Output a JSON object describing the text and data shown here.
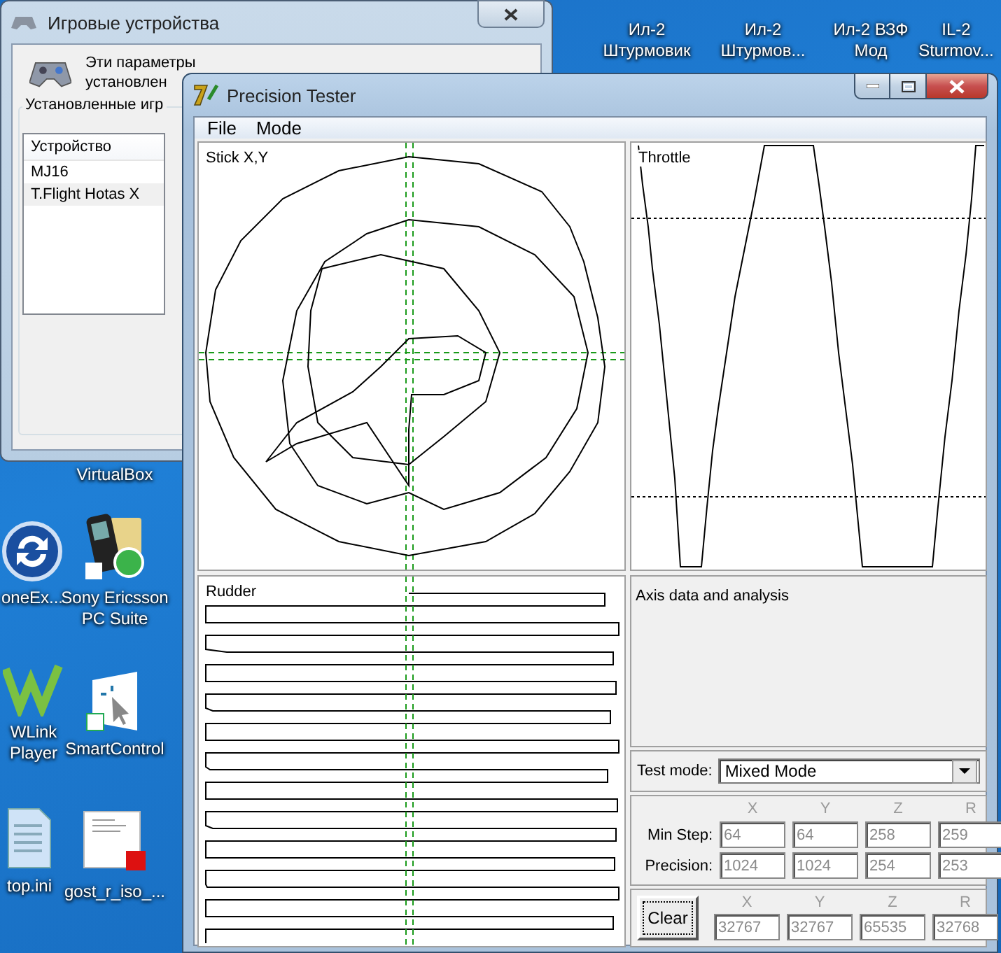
{
  "desktop_icons": [
    {
      "kind": "none",
      "lines": [
        "Ил-2",
        "Штурмовик"
      ]
    },
    {
      "kind": "none",
      "lines": [
        "Ил-2",
        "Штурмов..."
      ]
    },
    {
      "kind": "none",
      "lines": [
        "Ил-2 ВЗФ",
        "Мод"
      ]
    },
    {
      "kind": "none",
      "lines": [
        "IL-2",
        "Sturmov..."
      ]
    },
    {
      "kind": "none",
      "lines": [
        "VirtualBox"
      ]
    },
    {
      "kind": "sync",
      "lines": [
        "oneEx..."
      ]
    },
    {
      "kind": "phone",
      "lines": [
        "Sony Ericsson",
        "PC Suite"
      ]
    },
    {
      "kind": "player",
      "lines": [
        "WLink",
        "Player"
      ]
    },
    {
      "kind": "cursor",
      "lines": [
        "SmartControl"
      ]
    },
    {
      "kind": "file",
      "lines": [
        "top.ini"
      ]
    },
    {
      "kind": "pdf",
      "lines": [
        "gost_r_iso_..."
      ]
    }
  ],
  "back_window": {
    "title": "Игровые устройства",
    "description": [
      "Эти параметры",
      "установлен"
    ],
    "group_label": "Установленные игр",
    "list_header": "Устройство",
    "devices": [
      {
        "name": "MJ16",
        "selected": false
      },
      {
        "name": "T.Flight Hotas X",
        "selected": true
      }
    ]
  },
  "window": {
    "title": "Precision Tester",
    "menu": [
      "File",
      "Mode"
    ],
    "plots": {
      "stick": "Stick X,Y",
      "throttle": "Throttle",
      "rudder": "Rudder"
    },
    "analysis_text": "Axis data and analysis",
    "test_mode": {
      "label": "Test mode:",
      "value": "Mixed Mode"
    },
    "columns": [
      "X",
      "Y",
      "Z",
      "R"
    ],
    "rows": [
      {
        "label": "Min Step:",
        "values": [
          "64",
          "64",
          "258",
          "259"
        ]
      },
      {
        "label": "Precision:",
        "values": [
          "1024",
          "1024",
          "254",
          "253"
        ]
      }
    ],
    "clear_button": "Clear",
    "raw_columns": [
      "X",
      "Y",
      "Z",
      "R"
    ],
    "raw_values": [
      "32767",
      "32767",
      "65535",
      "32768"
    ]
  }
}
